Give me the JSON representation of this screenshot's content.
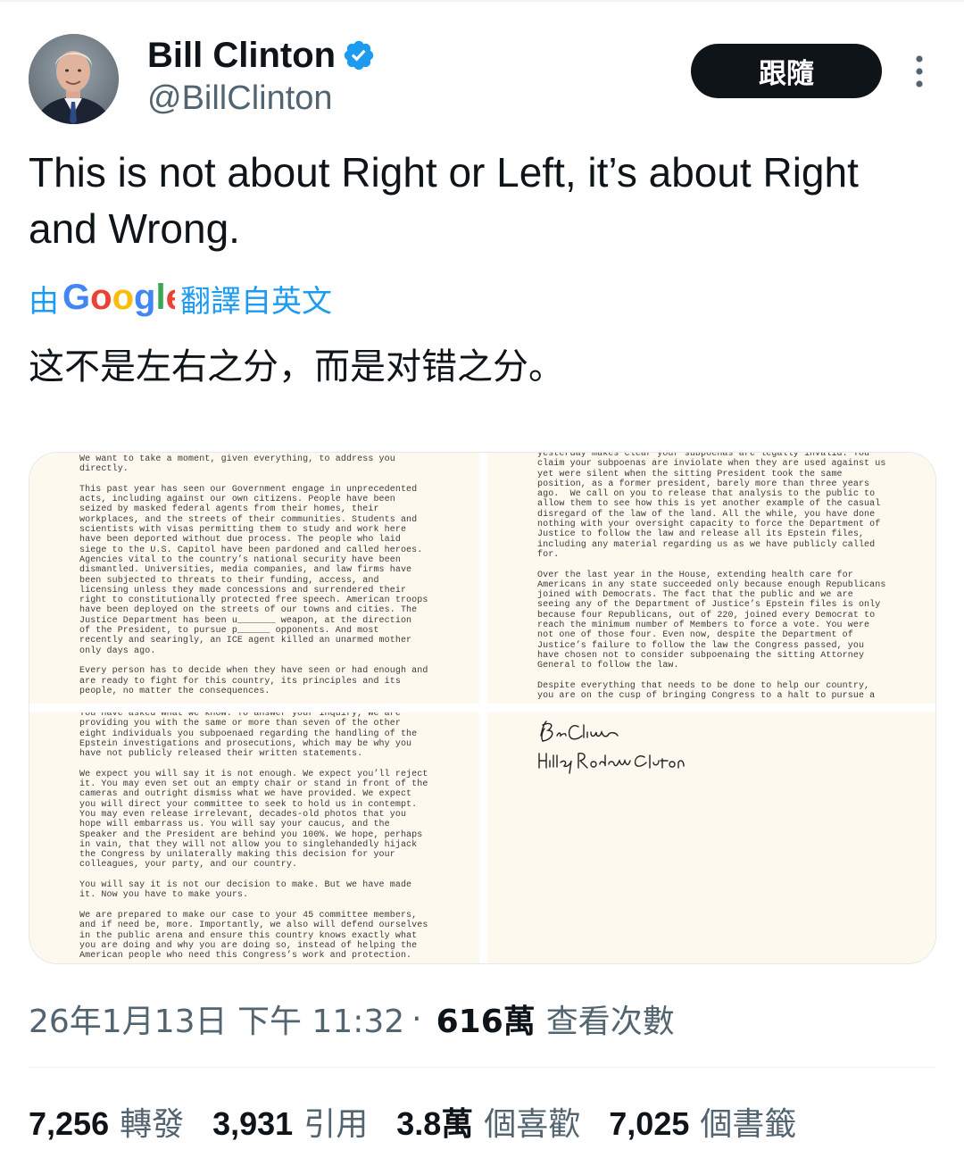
{
  "author": {
    "name": "Bill Clinton",
    "handle": "@BillClinton",
    "verified": true,
    "follow_label": "跟隨"
  },
  "tweet": {
    "text": "This is not about Right or Left, it’s about Right and Wrong.",
    "translate_by": "由",
    "translate_brand": "Google",
    "translate_from": "翻譯自英文",
    "translated_text": "这不是左右之分，而是对错之分。"
  },
  "media": {
    "page1_text": "We want to take a moment, given everything, to address you\ndirectly.\n\nThis past year has seen our Government engage in unprecedented\nacts, including against our own citizens. People have been\nseized by masked federal agents from their homes, their\nworkplaces, and the streets of their communities. Students and\nscientists with visas permitting them to study and work here\nhave been deported without due process. The people who laid\nsiege to the U.S. Capitol have been pardoned and called heroes.\nAgencies vital to the country’s national security have been\ndismantled. Universities, media companies, and law firms have\nbeen subjected to threats to their funding, access, and\nlicensing unless they made concessions and surrendered their\nright to constitutionally protected free speech. American troops\nhave been deployed on the streets of our towns and cities. The\nJustice Department has been u_______ weapon, at the direction\nof the President, to pursue p______ opponents. And most\nrecently and searingly, an ICE agent killed an unarmed mother\nonly days ago.\n\nEvery person has to decide when they have seen or had enough and\nare ready to fight for this country, its principles and its\npeople, no matter the consequences.",
    "page2_text": "yesterday makes clear your subpoenas are legally invalid. You\nclaim your subpoenas are inviolate when they are used against us\nyet were silent when the sitting President took the same\nposition, as a former president, barely more than three years\nago.  We call on you to release that analysis to the public to\nallow them to see how this is yet another example of the casual\ndisregard of the law of the land. All the while, you have done\nnothing with your oversight capacity to force the Department of\nJustice to follow the law and release all its Epstein files,\nincluding any material regarding us as we have publicly called\nfor.\n\nOver the last year in the House, extending health care for\nAmericans in any state succeeded only because enough Republicans\njoined with Democrats. The fact that the public and we are\nseeing any of the Department of Justice’s Epstein files is only\nbecause four Republicans, out of 220, joined every Democrat to\nreach the minimum number of Members to force a vote. You were\nnot one of those four. Even now, despite the Department of\nJustice’s failure to follow the law the Congress passed, you\nhave chosen not to consider subpoenaing the sitting Attorney\nGeneral to follow the law.\n\nDespite everything that needs to be done to help our country,\nyou are on the cusp of bringing Congress to a halt to pursue a",
    "page3_text": "You have asked what we know. To answer your inquiry, we are\nproviding you with the same or more than seven of the other\neight individuals you subpoenaed regarding the handling of the\nEpstein investigations and prosecutions, which may be why you\nhave not publicly released their written statements.\n\nWe expect you will say it is not enough. We expect you’ll reject\nit. You may even set out an empty chair or stand in front of the\ncameras and outright dismiss what we have provided. We expect\nyou will direct your committee to seek to hold us in contempt.\nYou may even release irrelevant, decades-old photos that you\nhope will embarrass us. You will say your caucus, and the\nSpeaker and the President are behind you 100%. We hope, perhaps\nin vain, that they will not allow you to singlehandedly hijack\nthe Congress by unilaterally making this decision for your\ncolleagues, your party, and our country.\n\nYou will say it is not our decision to make. But we have made\nit. Now you have to make yours.\n\nWe are prepared to make our case to your 45 committee members,\nand if need be, more. Importantly, we also will defend ourselves\nin the public arena and ensure this country knows exactly what\nyou are doing and why you are doing so, instead of helping the\nAmerican people who need this Congress’s work and protection.",
    "signature_1": "Bill Clinton",
    "signature_2": "Hillary Rodham Clinton"
  },
  "meta": {
    "timestamp": "26年1月13日 下午 11:32",
    "separator": "·",
    "views_count": "616萬",
    "views_label": "查看次數"
  },
  "stats": [
    {
      "count": "7,256",
      "label": "轉發"
    },
    {
      "count": "3,931",
      "label": "引用"
    },
    {
      "count": "3.8萬",
      "label": "個喜歡"
    },
    {
      "count": "7,025",
      "label": "個書籤"
    }
  ],
  "colors": {
    "accent": "#1d9bf0",
    "text": "#0f1419",
    "secondary": "#536471",
    "follow_bg": "#0f1419",
    "paper": "#fdf9ef"
  }
}
